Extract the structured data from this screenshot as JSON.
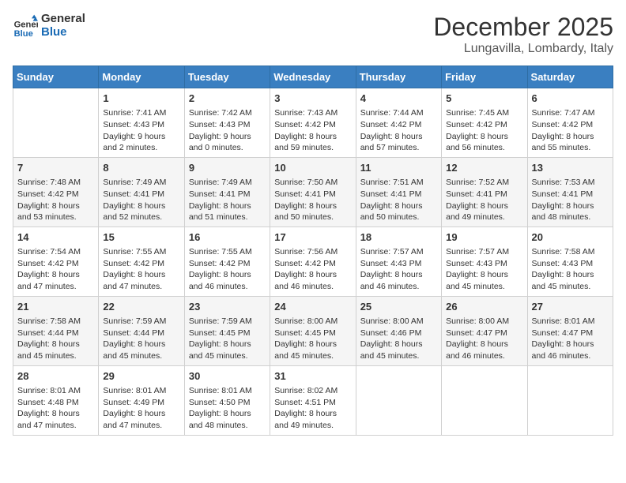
{
  "logo": {
    "line1": "General",
    "line2": "Blue"
  },
  "title": "December 2025",
  "subtitle": "Lungavilla, Lombardy, Italy",
  "weekdays": [
    "Sunday",
    "Monday",
    "Tuesday",
    "Wednesday",
    "Thursday",
    "Friday",
    "Saturday"
  ],
  "weeks": [
    [
      {
        "day": "",
        "text": ""
      },
      {
        "day": "1",
        "text": "Sunrise: 7:41 AM\nSunset: 4:43 PM\nDaylight: 9 hours\nand 2 minutes."
      },
      {
        "day": "2",
        "text": "Sunrise: 7:42 AM\nSunset: 4:43 PM\nDaylight: 9 hours\nand 0 minutes."
      },
      {
        "day": "3",
        "text": "Sunrise: 7:43 AM\nSunset: 4:42 PM\nDaylight: 8 hours\nand 59 minutes."
      },
      {
        "day": "4",
        "text": "Sunrise: 7:44 AM\nSunset: 4:42 PM\nDaylight: 8 hours\nand 57 minutes."
      },
      {
        "day": "5",
        "text": "Sunrise: 7:45 AM\nSunset: 4:42 PM\nDaylight: 8 hours\nand 56 minutes."
      },
      {
        "day": "6",
        "text": "Sunrise: 7:47 AM\nSunset: 4:42 PM\nDaylight: 8 hours\nand 55 minutes."
      }
    ],
    [
      {
        "day": "7",
        "text": "Sunrise: 7:48 AM\nSunset: 4:42 PM\nDaylight: 8 hours\nand 53 minutes."
      },
      {
        "day": "8",
        "text": "Sunrise: 7:49 AM\nSunset: 4:41 PM\nDaylight: 8 hours\nand 52 minutes."
      },
      {
        "day": "9",
        "text": "Sunrise: 7:49 AM\nSunset: 4:41 PM\nDaylight: 8 hours\nand 51 minutes."
      },
      {
        "day": "10",
        "text": "Sunrise: 7:50 AM\nSunset: 4:41 PM\nDaylight: 8 hours\nand 50 minutes."
      },
      {
        "day": "11",
        "text": "Sunrise: 7:51 AM\nSunset: 4:41 PM\nDaylight: 8 hours\nand 50 minutes."
      },
      {
        "day": "12",
        "text": "Sunrise: 7:52 AM\nSunset: 4:41 PM\nDaylight: 8 hours\nand 49 minutes."
      },
      {
        "day": "13",
        "text": "Sunrise: 7:53 AM\nSunset: 4:41 PM\nDaylight: 8 hours\nand 48 minutes."
      }
    ],
    [
      {
        "day": "14",
        "text": "Sunrise: 7:54 AM\nSunset: 4:42 PM\nDaylight: 8 hours\nand 47 minutes."
      },
      {
        "day": "15",
        "text": "Sunrise: 7:55 AM\nSunset: 4:42 PM\nDaylight: 8 hours\nand 47 minutes."
      },
      {
        "day": "16",
        "text": "Sunrise: 7:55 AM\nSunset: 4:42 PM\nDaylight: 8 hours\nand 46 minutes."
      },
      {
        "day": "17",
        "text": "Sunrise: 7:56 AM\nSunset: 4:42 PM\nDaylight: 8 hours\nand 46 minutes."
      },
      {
        "day": "18",
        "text": "Sunrise: 7:57 AM\nSunset: 4:43 PM\nDaylight: 8 hours\nand 46 minutes."
      },
      {
        "day": "19",
        "text": "Sunrise: 7:57 AM\nSunset: 4:43 PM\nDaylight: 8 hours\nand 45 minutes."
      },
      {
        "day": "20",
        "text": "Sunrise: 7:58 AM\nSunset: 4:43 PM\nDaylight: 8 hours\nand 45 minutes."
      }
    ],
    [
      {
        "day": "21",
        "text": "Sunrise: 7:58 AM\nSunset: 4:44 PM\nDaylight: 8 hours\nand 45 minutes."
      },
      {
        "day": "22",
        "text": "Sunrise: 7:59 AM\nSunset: 4:44 PM\nDaylight: 8 hours\nand 45 minutes."
      },
      {
        "day": "23",
        "text": "Sunrise: 7:59 AM\nSunset: 4:45 PM\nDaylight: 8 hours\nand 45 minutes."
      },
      {
        "day": "24",
        "text": "Sunrise: 8:00 AM\nSunset: 4:45 PM\nDaylight: 8 hours\nand 45 minutes."
      },
      {
        "day": "25",
        "text": "Sunrise: 8:00 AM\nSunset: 4:46 PM\nDaylight: 8 hours\nand 45 minutes."
      },
      {
        "day": "26",
        "text": "Sunrise: 8:00 AM\nSunset: 4:47 PM\nDaylight: 8 hours\nand 46 minutes."
      },
      {
        "day": "27",
        "text": "Sunrise: 8:01 AM\nSunset: 4:47 PM\nDaylight: 8 hours\nand 46 minutes."
      }
    ],
    [
      {
        "day": "28",
        "text": "Sunrise: 8:01 AM\nSunset: 4:48 PM\nDaylight: 8 hours\nand 47 minutes."
      },
      {
        "day": "29",
        "text": "Sunrise: 8:01 AM\nSunset: 4:49 PM\nDaylight: 8 hours\nand 47 minutes."
      },
      {
        "day": "30",
        "text": "Sunrise: 8:01 AM\nSunset: 4:50 PM\nDaylight: 8 hours\nand 48 minutes."
      },
      {
        "day": "31",
        "text": "Sunrise: 8:02 AM\nSunset: 4:51 PM\nDaylight: 8 hours\nand 49 minutes."
      },
      {
        "day": "",
        "text": ""
      },
      {
        "day": "",
        "text": ""
      },
      {
        "day": "",
        "text": ""
      }
    ]
  ]
}
